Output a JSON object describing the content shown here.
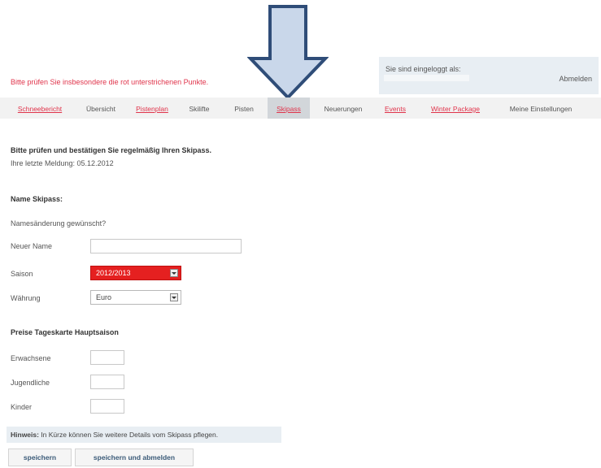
{
  "header": {
    "login_text": "Sie sind eingeloggt als:",
    "logout_label": "Abmelden",
    "warning": "Bitte prüfen Sie insbesondere die rot unterstrichenen Punkte."
  },
  "nav": {
    "items": [
      {
        "label": "Schneebericht",
        "style": "link"
      },
      {
        "label": "Übersicht",
        "style": "plain"
      },
      {
        "label": "Pistenplan",
        "style": "link"
      },
      {
        "label": "Skilifte",
        "style": "plain"
      },
      {
        "label": "Pisten",
        "style": "plain"
      },
      {
        "label": "Skipass",
        "style": "active"
      },
      {
        "label": "Neuerungen",
        "style": "plain"
      },
      {
        "label": "Events",
        "style": "link"
      },
      {
        "label": "Winter Package",
        "style": "link"
      },
      {
        "label": "Meine Einstellungen",
        "style": "plain"
      }
    ]
  },
  "main": {
    "intro_heading": "Bitte prüfen und bestätigen Sie regelmäßig Ihren Skipass.",
    "last_report": "Ihre letzte Meldung: 05.12.2012",
    "name_section_heading": "Name Skipass:",
    "name_change_question": "Namesänderung gewünscht?",
    "new_name_label": "Neuer Name",
    "new_name_value": "",
    "season_label": "Saison",
    "season_value": "2012/2013",
    "currency_label": "Währung",
    "currency_value": "Euro",
    "prices_heading": "Preise Tageskarte Hauptsaison",
    "adults_label": "Erwachsene",
    "youth_label": "Jugendliche",
    "children_label": "Kinder",
    "adults_value": "",
    "youth_value": "",
    "children_value": ""
  },
  "hint": {
    "bold": "Hinweis:",
    "text": " In Kürze können Sie weitere Details vom Skipass pflegen."
  },
  "buttons": {
    "save": "speichern",
    "save_logout": "speichern und abmelden"
  },
  "colors": {
    "accent_red": "#e0344b",
    "season_select_red": "#e52020",
    "arrow_fill": "#c9d7ea",
    "arrow_stroke": "#2f4d78"
  }
}
